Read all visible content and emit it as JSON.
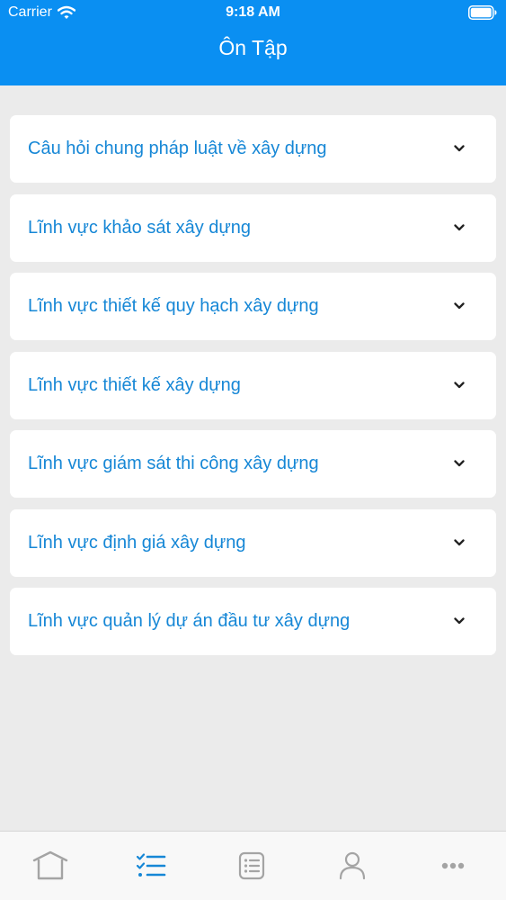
{
  "status_bar": {
    "carrier": "Carrier",
    "time": "9:18 AM",
    "wifi_icon": "wifi-icon",
    "battery_icon": "battery-icon"
  },
  "header": {
    "title": "Ôn Tập"
  },
  "colors": {
    "header_background": "#0a8ff2",
    "item_text": "#1687d6",
    "page_background": "#ebebeb",
    "tab_active": "#1687d6",
    "tab_inactive": "#a4a4a4"
  },
  "review_topics": [
    {
      "label": "Câu hỏi chung pháp luật về xây dựng",
      "icon": "chevron-down-icon"
    },
    {
      "label": "Lĩnh vực khảo sát xây dựng",
      "icon": "chevron-down-icon"
    },
    {
      "label": "Lĩnh vực thiết kế quy hạch xây dựng",
      "icon": "chevron-down-icon"
    },
    {
      "label": "Lĩnh vực thiết kế xây dựng",
      "icon": "chevron-down-icon"
    },
    {
      "label": "Lĩnh vực giám sát thi công xây dựng",
      "icon": "chevron-down-icon"
    },
    {
      "label": "Lĩnh vực định giá xây dựng",
      "icon": "chevron-down-icon"
    },
    {
      "label": "Lĩnh vực quản lý dự án đầu tư xây dựng",
      "icon": "chevron-down-icon"
    }
  ],
  "tab_bar": {
    "tabs": [
      {
        "icon": "home-icon",
        "active": false
      },
      {
        "icon": "checklist-icon",
        "active": true
      },
      {
        "icon": "list-card-icon",
        "active": false
      },
      {
        "icon": "person-icon",
        "active": false
      },
      {
        "icon": "more-icon",
        "active": false
      }
    ]
  }
}
